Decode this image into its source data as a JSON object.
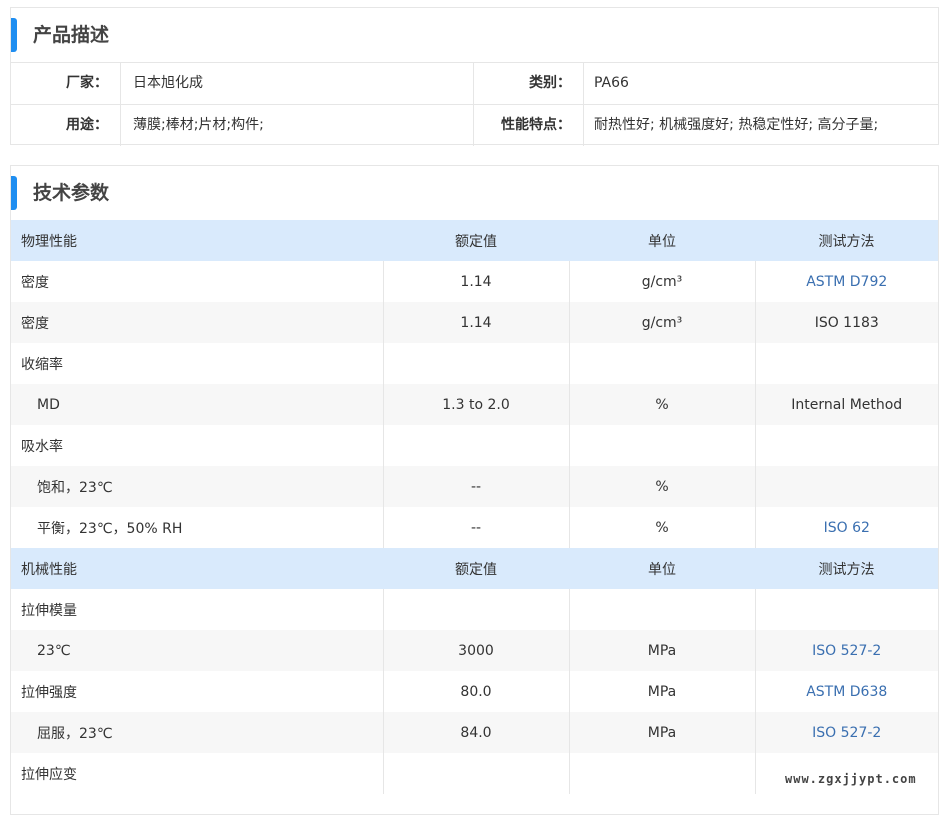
{
  "description": {
    "title": "产品描述",
    "rows": [
      {
        "label1": "厂家：",
        "value1": "日本旭化成",
        "label2": "类别：",
        "value2": "PA66"
      },
      {
        "label1": "用途：",
        "value1": "薄膜;棒材;片材;构件;",
        "label2": "性能特点：",
        "value2": "耐热性好; 机械强度好; 热稳定性好; 高分子量;"
      }
    ]
  },
  "tech": {
    "title": "技术参数",
    "physical_header": {
      "property": "物理性能",
      "value": "额定值",
      "unit": "单位",
      "method": "测试方法"
    },
    "physical_rows": [
      {
        "property": "密度",
        "value": "1.14",
        "unit": "g/cm³",
        "method": "ASTM D792"
      },
      {
        "property": "密度",
        "value": "1.14",
        "unit": "g/cm³",
        "method": "ISO 1183"
      },
      {
        "property": "收缩率",
        "value": "",
        "unit": "",
        "method": ""
      },
      {
        "property": "MD",
        "value": "1.3 to 2.0",
        "unit": "%",
        "method": "Internal Method"
      },
      {
        "property": "吸水率",
        "value": "",
        "unit": "",
        "method": ""
      },
      {
        "property": "饱和，23℃",
        "value": "--",
        "unit": "%",
        "method": ""
      },
      {
        "property": "平衡，23℃，50% RH",
        "value": "--",
        "unit": "%",
        "method": "ISO 62"
      }
    ],
    "mechanical_header": {
      "property": "机械性能",
      "value": "额定值",
      "unit": "单位",
      "method": "测试方法"
    },
    "mechanical_rows": [
      {
        "property": "拉伸模量",
        "value": "",
        "unit": "",
        "method": ""
      },
      {
        "property": "23℃",
        "value": "3000",
        "unit": "MPa",
        "method": "ISO 527-2"
      },
      {
        "property": "拉伸强度",
        "value": "80.0",
        "unit": "MPa",
        "method": "ASTM D638"
      },
      {
        "property": "屈服，23℃",
        "value": "84.0",
        "unit": "MPa",
        "method": "ISO 527-2"
      },
      {
        "property": "拉伸应变",
        "value": "",
        "unit": "",
        "method": ""
      }
    ]
  },
  "watermark": "www.zgxjjypt.com",
  "colors": {
    "accent": "#1f8ef1",
    "header_bg": "#d9eafc",
    "link": "#3a6fb0"
  }
}
